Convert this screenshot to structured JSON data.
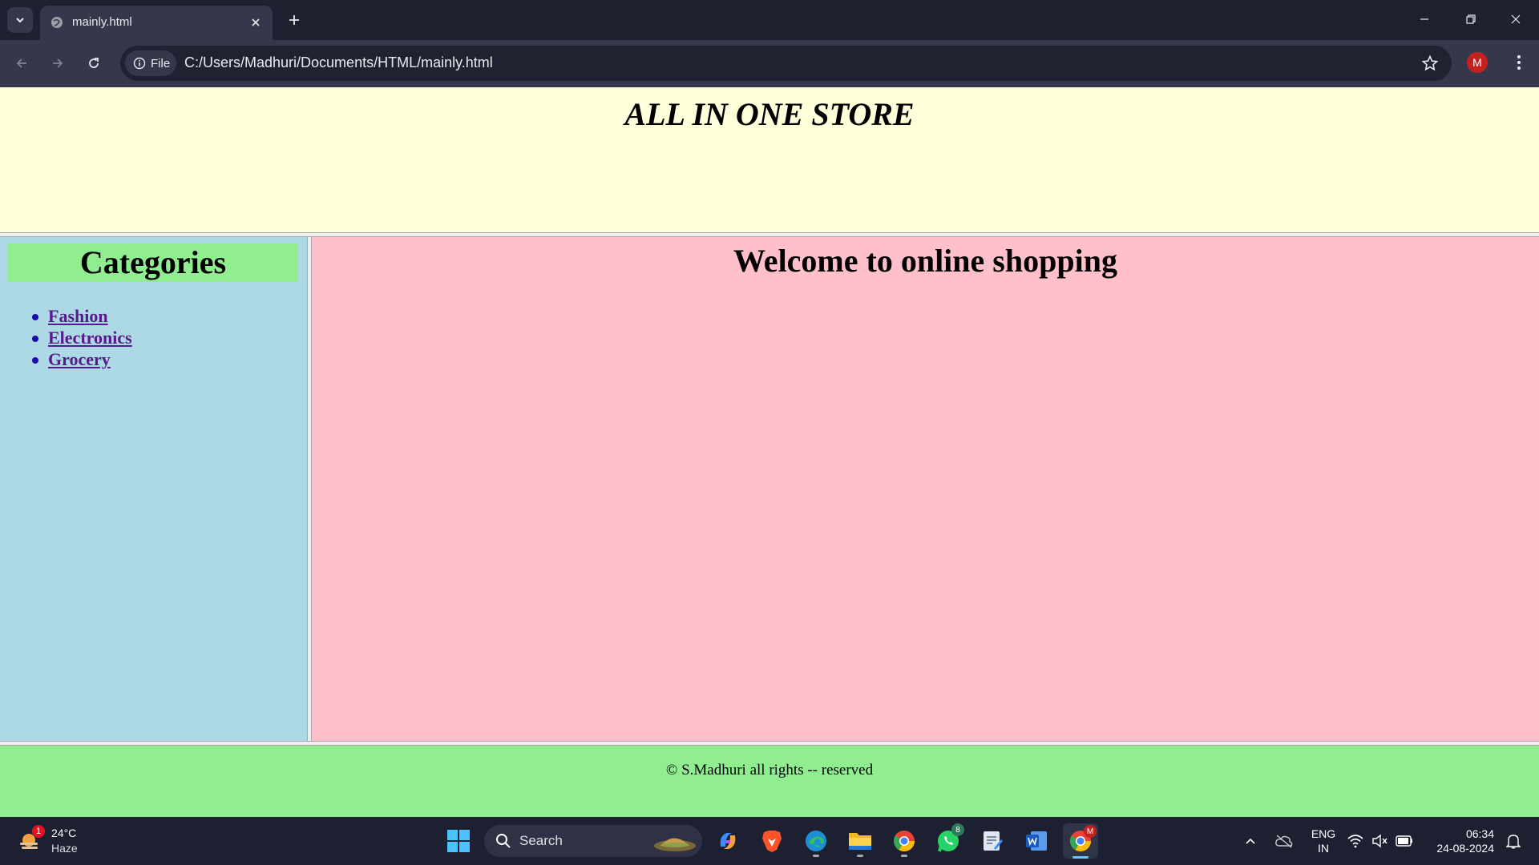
{
  "browser": {
    "tab_title": "mainly.html",
    "file_chip": "File",
    "url": "C:/Users/Madhuri/Documents/HTML/mainly.html",
    "profile_initial": "M"
  },
  "page": {
    "header_title": "ALL IN ONE STORE",
    "categories_heading": "Categories",
    "categories": [
      "Fashion",
      "Electronics",
      "Grocery"
    ],
    "welcome": "Welcome to online shopping",
    "footer": "© S.Madhuri all rights -- reserved",
    "colors": {
      "header_bg": "#ffffdc",
      "sidebar_bg": "#add8e6",
      "heading_bg": "#90ee90",
      "main_bg": "#ffc0cb",
      "footer_bg": "#90ee90"
    }
  },
  "taskbar": {
    "weather": {
      "badge": "1",
      "temp": "24°C",
      "condition": "Haze"
    },
    "search_label": "Search",
    "whatsapp_badge": "8",
    "chrome_profile_badge": "M",
    "lang_line1": "ENG",
    "lang_line2": "IN",
    "time": "06:34",
    "date": "24-08-2024",
    "icons": [
      "start-icon",
      "copilot-icon",
      "brave-icon",
      "edge-icon",
      "file-explorer-icon",
      "chrome-icon",
      "whatsapp-icon",
      "notepad-icon",
      "word-icon",
      "chrome-profile-icon"
    ]
  }
}
